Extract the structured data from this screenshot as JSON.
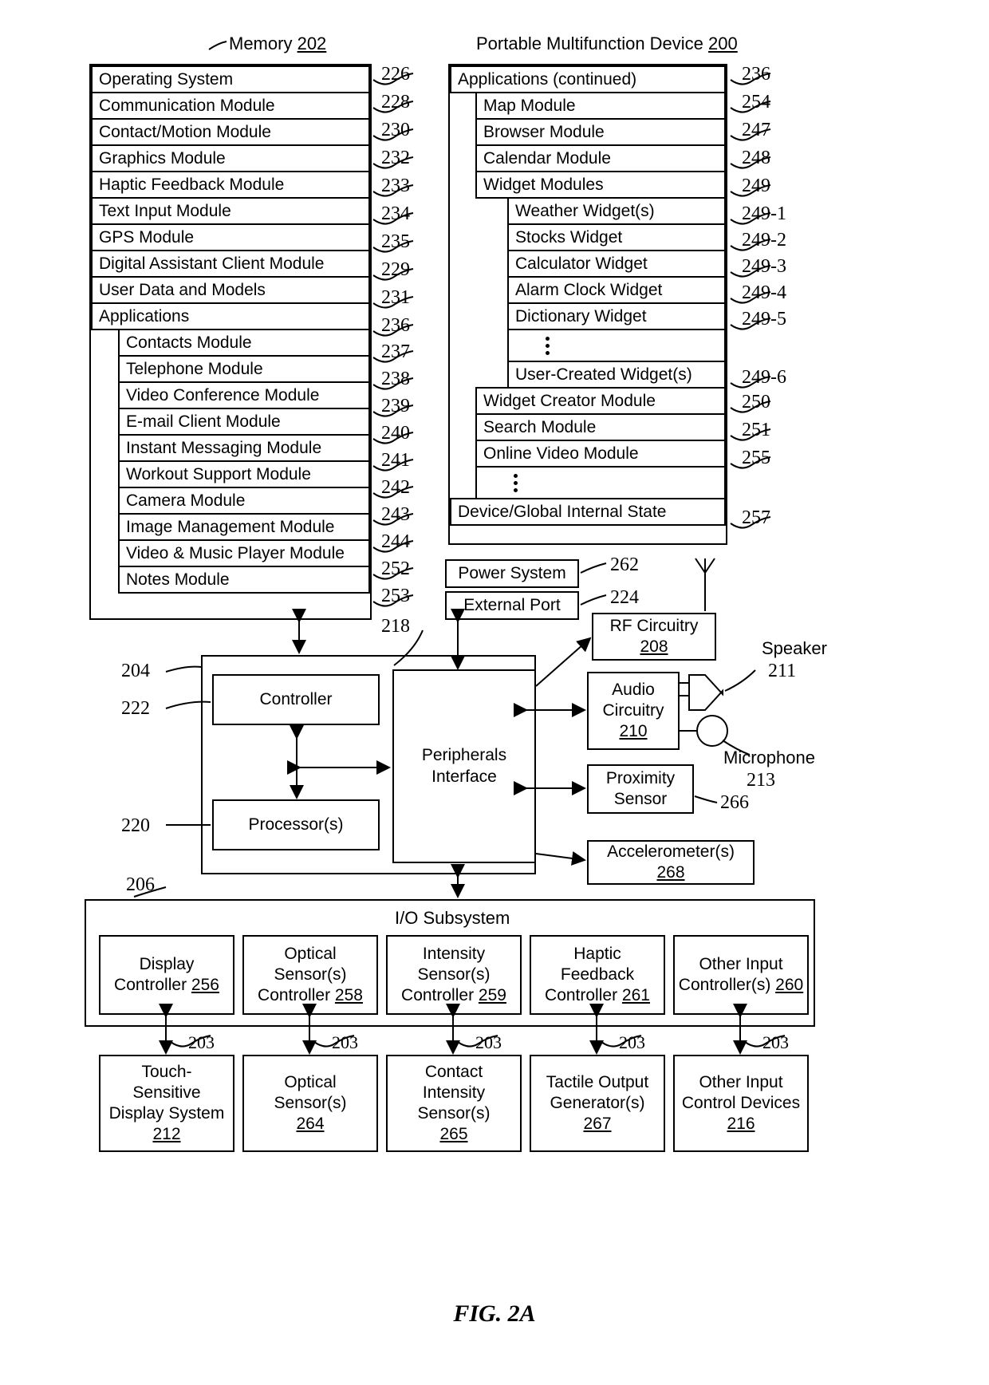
{
  "figure": {
    "caption": "FIG. 2A"
  },
  "memory": {
    "title": "Memory",
    "title_ref": "202",
    "items": [
      {
        "label": "Operating System",
        "ref": "226"
      },
      {
        "label": "Communication Module",
        "ref": "228"
      },
      {
        "label": "Contact/Motion Module",
        "ref": "230"
      },
      {
        "label": "Graphics Module",
        "ref": "232"
      },
      {
        "label": "Haptic Feedback Module",
        "ref": "233"
      },
      {
        "label": "Text Input Module",
        "ref": "234"
      },
      {
        "label": "GPS Module",
        "ref": "235"
      },
      {
        "label": "Digital Assistant Client Module",
        "ref": "229"
      },
      {
        "label": "User Data and Models",
        "ref": "231"
      },
      {
        "label": "Applications",
        "ref": "236"
      }
    ],
    "applications": [
      {
        "label": "Contacts Module",
        "ref": "237"
      },
      {
        "label": "Telephone Module",
        "ref": "238"
      },
      {
        "label": "Video Conference Module",
        "ref": "239"
      },
      {
        "label": "E-mail Client Module",
        "ref": "240"
      },
      {
        "label": "Instant Messaging Module",
        "ref": "241"
      },
      {
        "label": "Workout Support Module",
        "ref": "242"
      },
      {
        "label": "Camera Module",
        "ref": "243"
      },
      {
        "label": "Image Management Module",
        "ref": "244"
      },
      {
        "label": "Video & Music Player Module",
        "ref": "252"
      },
      {
        "label": "Notes Module",
        "ref": "253"
      }
    ]
  },
  "device": {
    "title": "Portable Multifunction Device",
    "title_ref": "200",
    "applications_continued": {
      "label": "Applications (continued)",
      "ref": "236"
    },
    "items": [
      {
        "label": "Map Module",
        "ref": "254"
      },
      {
        "label": "Browser Module",
        "ref": "247"
      },
      {
        "label": "Calendar Module",
        "ref": "248"
      },
      {
        "label": "Widget Modules",
        "ref": "249"
      }
    ],
    "widgets": [
      {
        "label": "Weather Widget(s)",
        "ref": "249-1"
      },
      {
        "label": "Stocks Widget",
        "ref": "249-2"
      },
      {
        "label": "Calculator Widget",
        "ref": "249-3"
      },
      {
        "label": "Alarm Clock Widget",
        "ref": "249-4"
      },
      {
        "label": "Dictionary Widget",
        "ref": "249-5"
      },
      {
        "label": "",
        "ref": "",
        "ellipsis": true
      },
      {
        "label": "User-Created Widget(s)",
        "ref": "249-6"
      }
    ],
    "items_after": [
      {
        "label": "Widget Creator Module",
        "ref": "250"
      },
      {
        "label": "Search Module",
        "ref": "251"
      },
      {
        "label": "Online Video Module",
        "ref": "255"
      }
    ],
    "internal_state": {
      "label": "Device/Global Internal State",
      "ref": "257"
    }
  },
  "power": {
    "power_system": {
      "label": "Power System",
      "ref": "262"
    },
    "external_port": {
      "label": "External Port",
      "ref": "224"
    }
  },
  "core": {
    "box_ref_outer": "204",
    "controller": {
      "label": "Controller",
      "ref": "222"
    },
    "processor": {
      "label": "Processor(s)",
      "ref": "220"
    },
    "peripherals": {
      "label": "Peripherals",
      "label2": "Interface",
      "ref": "218"
    },
    "bus_label": "203"
  },
  "peripherals_right": {
    "rf": {
      "label": "RF Circuitry",
      "ref": "208"
    },
    "audio": {
      "label": "Audio",
      "label2": "Circuitry",
      "ref": "210"
    },
    "speaker": {
      "label": "Speaker",
      "ref": "211"
    },
    "microphone": {
      "label": "Microphone",
      "ref": "213"
    },
    "proximity": {
      "label": "Proximity",
      "label2": "Sensor",
      "ref": "266"
    },
    "accelerometer": {
      "label": "Accelerometer(s)",
      "ref": "268"
    }
  },
  "io_subsystem": {
    "title": "I/O Subsystem",
    "ref": "206",
    "controllers": [
      {
        "line1": "Display",
        "line2": "Controller",
        "ref": "256"
      },
      {
        "line1": "Optical",
        "line2": "Sensor(s)",
        "line3": "Controller",
        "ref": "258"
      },
      {
        "line1": "Intensity",
        "line2": "Sensor(s)",
        "line3": "Controller",
        "ref": "259"
      },
      {
        "line1": "Haptic",
        "line2": "Feedback",
        "line3": "Controller",
        "ref": "261"
      },
      {
        "line1": "Other Input",
        "line2": "Controller(s)",
        "ref": "260"
      }
    ],
    "devices": [
      {
        "line1": "Touch-",
        "line2": "Sensitive",
        "line3": "Display System",
        "ref": "212"
      },
      {
        "line1": "Optical",
        "line2": "Sensor(s)",
        "ref": "264"
      },
      {
        "line1": "Contact",
        "line2": "Intensity",
        "line3": "Sensor(s)",
        "ref": "265"
      },
      {
        "line1": "Tactile Output",
        "line2": "Generator(s)",
        "ref": "267"
      },
      {
        "line1": "Other Input",
        "line2": "Control Devices",
        "ref": "216"
      }
    ],
    "bus_label": "203"
  }
}
